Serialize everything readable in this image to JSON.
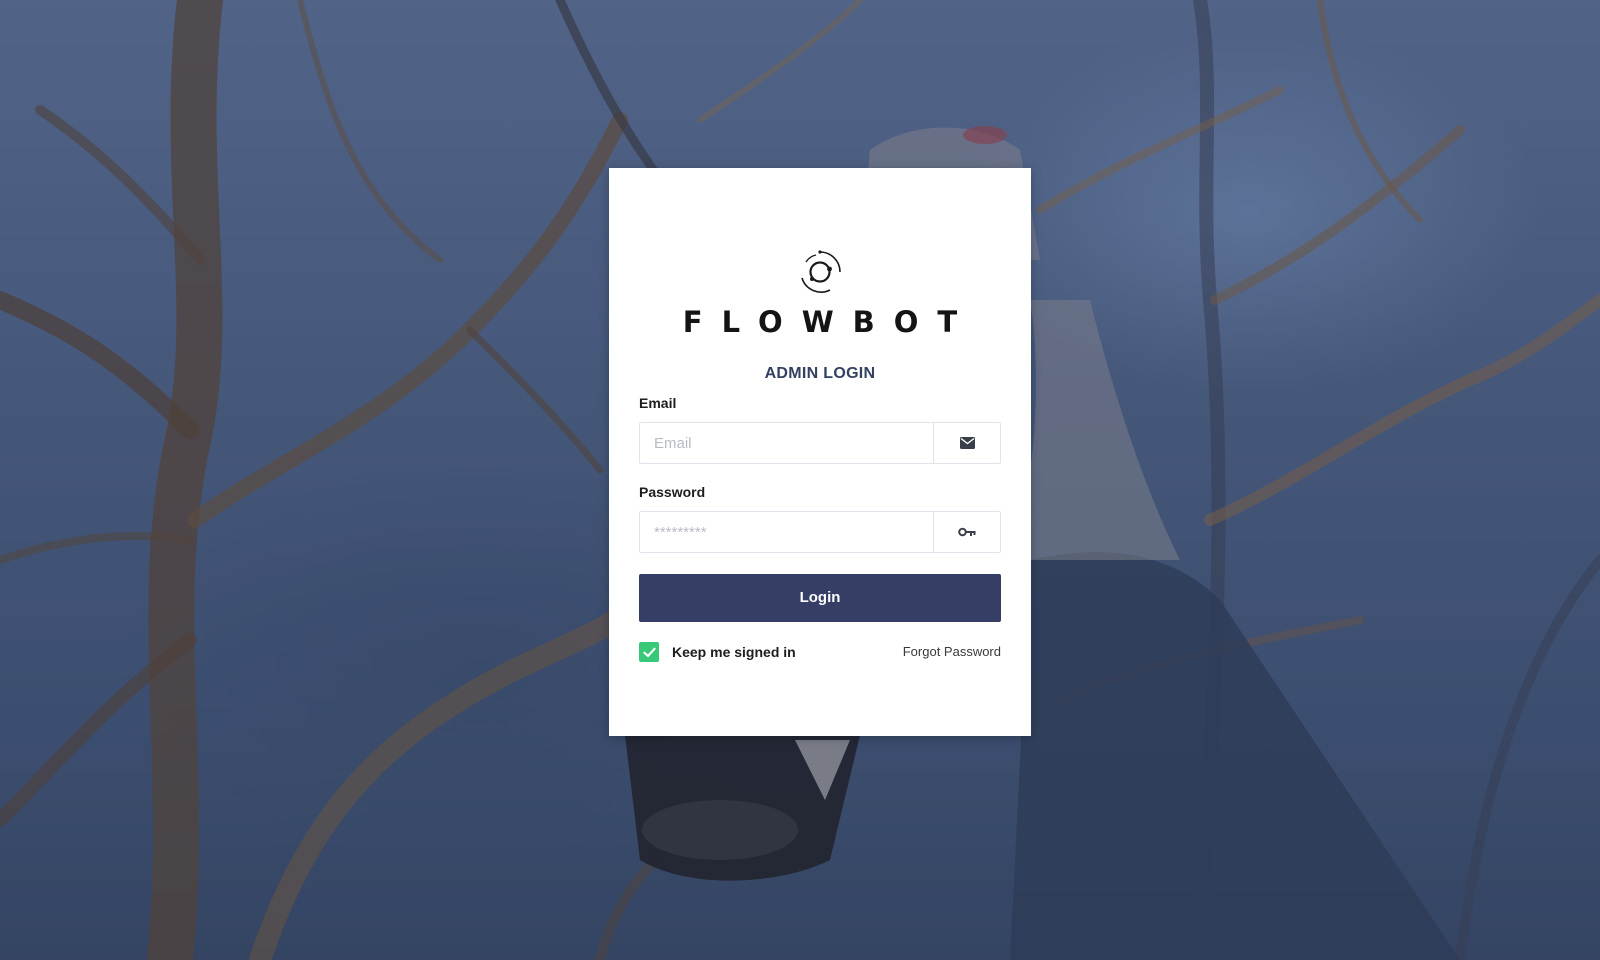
{
  "brand": {
    "name": "FLOWBOT",
    "logo_icon": "orbit-logo-icon"
  },
  "login": {
    "title": "ADMIN LOGIN",
    "email": {
      "label": "Email",
      "placeholder": "Email",
      "value": "",
      "icon": "envelope-icon"
    },
    "password": {
      "label": "Password",
      "placeholder": "*********",
      "value": "",
      "icon": "key-icon"
    },
    "submit_label": "Login",
    "remember": {
      "label": "Keep me signed in",
      "checked": true
    },
    "forgot_label": "Forgot Password"
  },
  "colors": {
    "primary": "#363e66",
    "title": "#33405f",
    "checkbox": "#37c878",
    "card_bg": "#ffffff"
  }
}
